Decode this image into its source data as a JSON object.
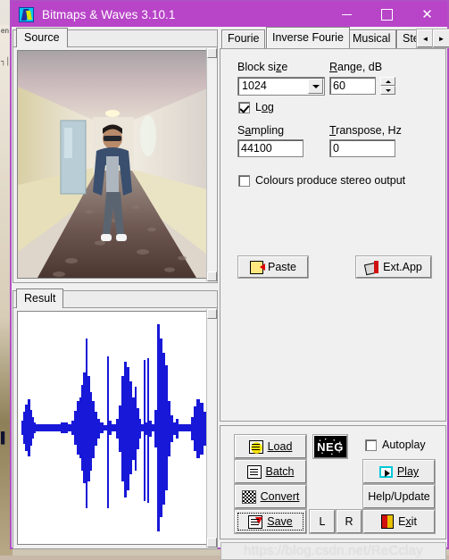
{
  "window": {
    "title": "Bitmaps & Waves 3.10.1",
    "icon": "app-icon",
    "titlebar_color": "#b844c8",
    "border_color": "#b14fc4",
    "minimize": "—",
    "maximize": "□",
    "close": "✕"
  },
  "left": {
    "source_tab": "Source",
    "result_tab": "Result",
    "waveform_color": "#1818d8",
    "source_image_alt": "hotel hallway photo with a person standing in the corridor"
  },
  "right": {
    "tabs": [
      {
        "label": "Fourie",
        "selected": false
      },
      {
        "label": "Inverse Fourie",
        "selected": true
      },
      {
        "label": "Musical",
        "selected": false
      },
      {
        "label": "Stereo",
        "selected": false
      }
    ],
    "tab_scroll_left": "◄",
    "tab_scroll_right": "►",
    "fields": {
      "block_size_label": "Block size",
      "block_size_value": "1024",
      "range_label": "Range, dB",
      "range_value": "60",
      "log_label": "Log",
      "log_checked": true,
      "sampling_label": "Sampling",
      "sampling_value": "44100",
      "transpose_label": "Transpose, Hz",
      "transpose_value": "0",
      "colours_stereo_label": "Colours produce stereo output",
      "colours_stereo_checked": false
    },
    "buttons": {
      "paste": "Paste",
      "ext_app": "Ext.App"
    }
  },
  "actions": {
    "load": "Load",
    "batch": "Batch",
    "convert": "Convert",
    "save": "Save",
    "left_channel": "L",
    "right_channel": "R",
    "neg": "NEG",
    "autoplay_label": "Autoplay",
    "autoplay_checked": false,
    "play": "Play",
    "help_update": "Help/Update",
    "exit": "Exit"
  },
  "watermark": "https://blog.csdn.net/ReCclay",
  "backdrop": {
    "line1": "en",
    "line2": "┐│┤",
    "line3": "▌"
  }
}
